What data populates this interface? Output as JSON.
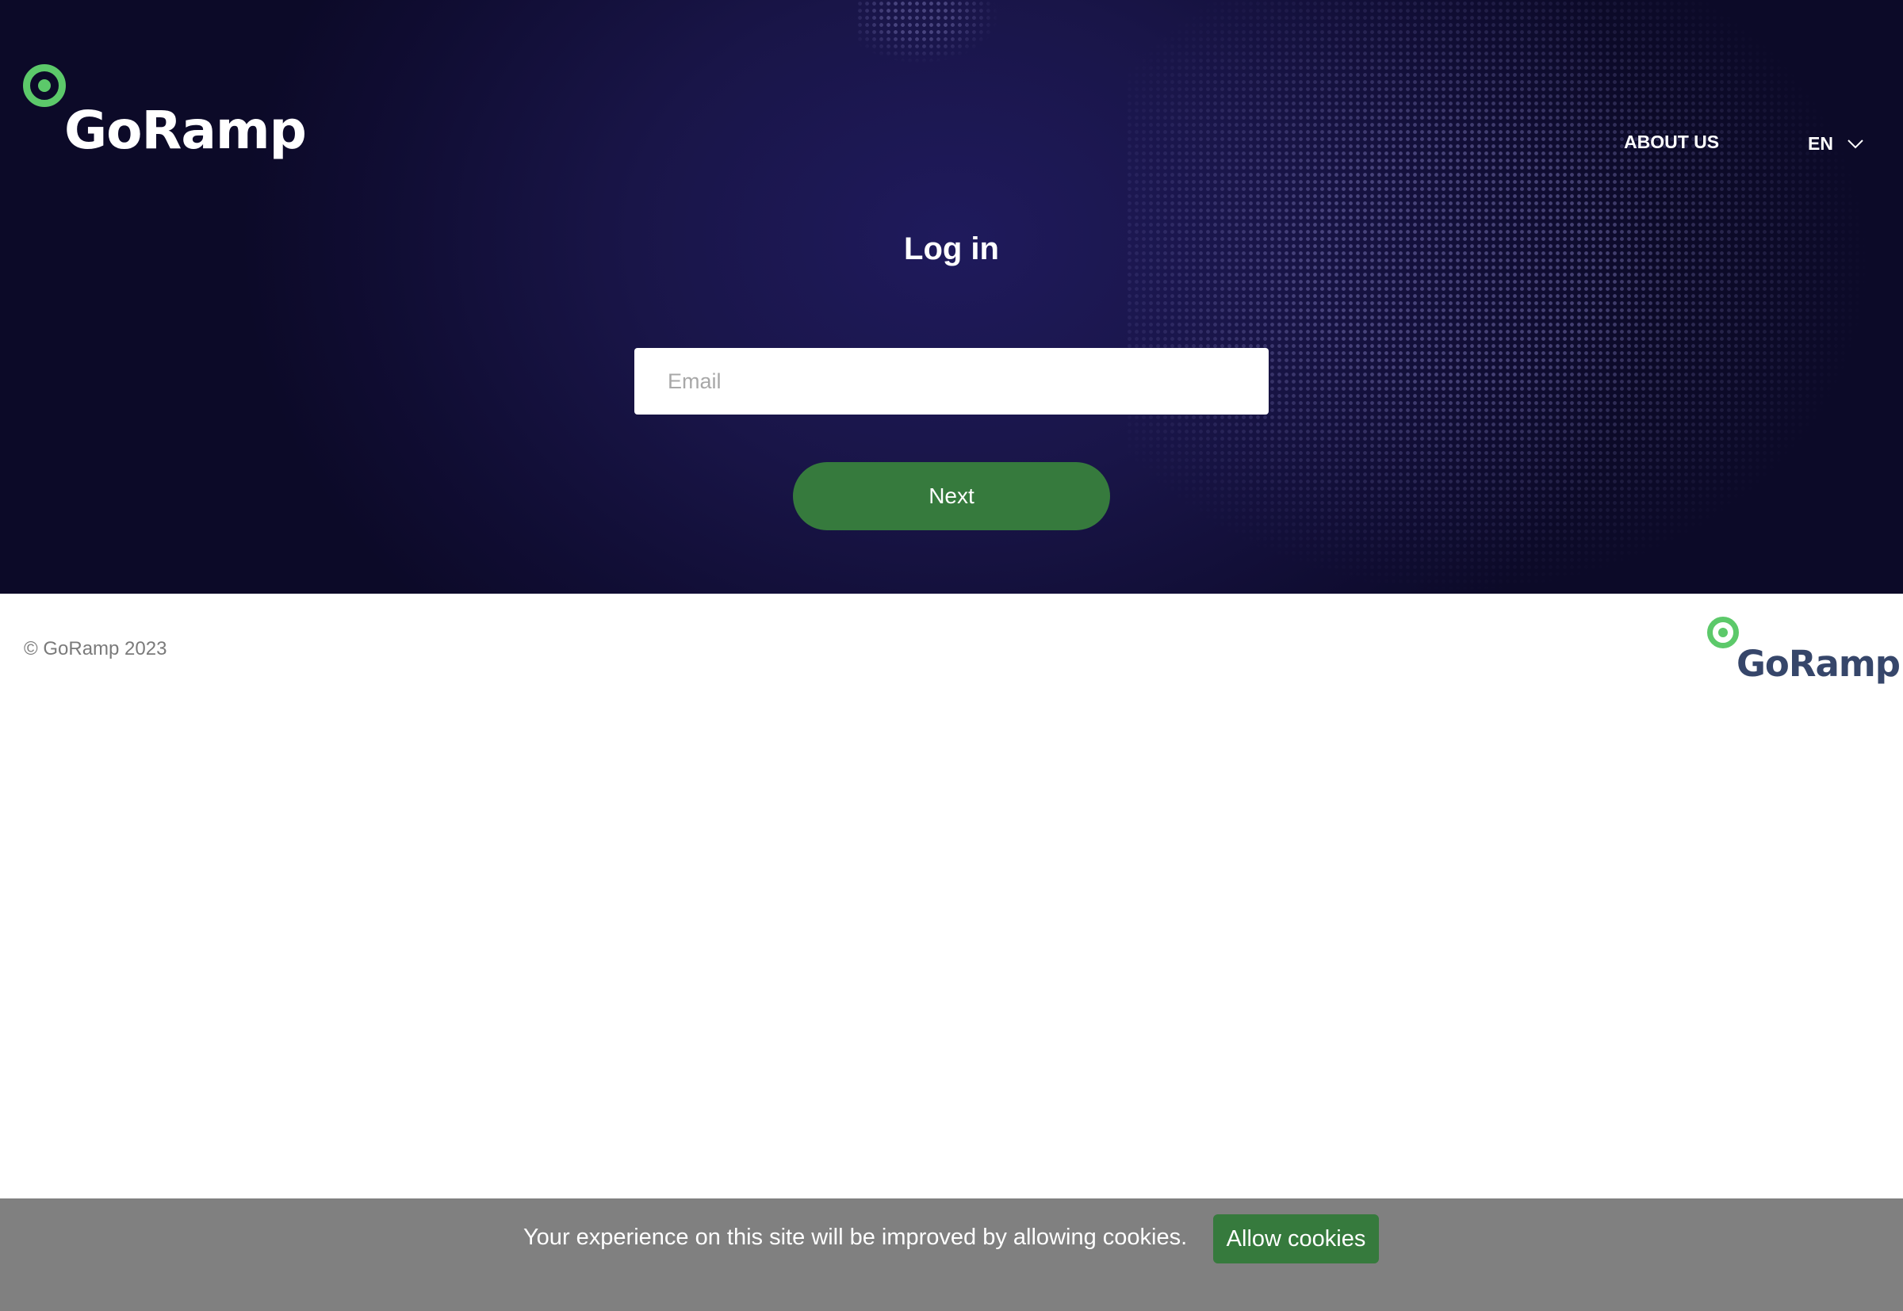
{
  "brand": {
    "name": "GoRamp",
    "accent": "#5cc96a",
    "dark_text": "#36466a"
  },
  "header": {
    "about_label": "ABOUT US",
    "language": "EN"
  },
  "login": {
    "title": "Log in",
    "email_placeholder": "Email",
    "email_value": "",
    "next_label": "Next",
    "button_color": "#367a3d"
  },
  "footer": {
    "copyright": "© GoRamp 2023"
  },
  "cookies": {
    "message": "Your experience on this site will be improved by allowing cookies.",
    "allow_label": "Allow cookies"
  }
}
